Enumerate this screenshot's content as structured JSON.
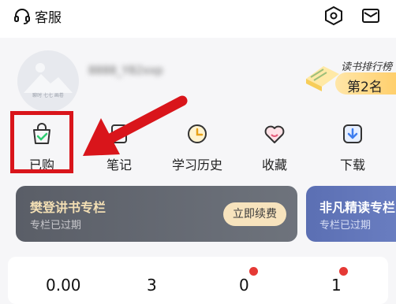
{
  "header": {
    "customer_service_label": "客服",
    "customer_service_icon": "headset-icon",
    "settings_icon": "hexagon-settings-icon",
    "message_icon": "mail-icon"
  },
  "profile": {
    "avatar_caption": "聊时 七七 画卷",
    "username_blurred": "8888_Y82xxp"
  },
  "ranking": {
    "label": "读书排行榜",
    "value": "第2名"
  },
  "menu": {
    "items": [
      {
        "label": "已购",
        "icon": "shopping-bag-icon"
      },
      {
        "label": "笔记",
        "icon": "note-icon"
      },
      {
        "label": "学习历史",
        "icon": "clock-icon"
      },
      {
        "label": "收藏",
        "icon": "heart-icon"
      },
      {
        "label": "下载",
        "icon": "download-icon"
      }
    ]
  },
  "cards": [
    {
      "title": "樊登讲书专栏",
      "subtitle": "专栏已过期",
      "button": "立即续费"
    },
    {
      "title": "非凡精读专栏",
      "subtitle": "专栏已过期"
    }
  ],
  "stats": [
    "0.00",
    "3",
    "0",
    "1"
  ],
  "colors": {
    "highlight": "#d9151b",
    "accent_gold": "#ffcf6c",
    "dark_card": "#5a5e67",
    "blue_card": "#5b6fb3",
    "badge_red": "#e53935"
  }
}
